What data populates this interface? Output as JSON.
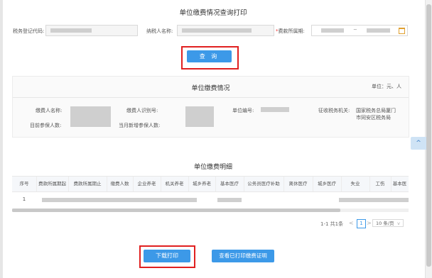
{
  "page_title": "单位缴费情况查询打印",
  "search": {
    "tax_code_label": "税务登记代码:",
    "taxpayer_name_label": "纳税人名称:",
    "period_required": "*",
    "period_label": "费款所属期:",
    "date_separator": "~",
    "calendar_icon": "calendar-icon",
    "query_label": "查 询"
  },
  "summary": {
    "title": "单位缴费情况",
    "unit": "单位：元、人",
    "payer_name_label": "缴费人名称:",
    "payer_id_label": "缴费人识别号:",
    "unit_no_label": "单位编号:",
    "tax_office_label": "征收税务机关:",
    "tax_office_value_line1": "国家税务总局厦门",
    "tax_office_value_line2": "市同安区税务局",
    "insured_count_label": "目前参保人数:",
    "new_insured_label": "当月新增参保人数:"
  },
  "detail": {
    "title": "单位缴费明细",
    "columns": [
      "序号",
      "费款所属期起",
      "费款所属期止",
      "缴费人数",
      "企业养老",
      "机关养老",
      "城乡养老",
      "基本医疗",
      "公务员医疗补助",
      "离休医疗",
      "城乡医疗",
      "失业",
      "工伤",
      "基本医"
    ],
    "rows": [
      {
        "index": "1"
      }
    ]
  },
  "pagination": {
    "summary": "1-1 共1条",
    "prev": "<",
    "current": "1",
    "next": ">",
    "page_size": "10 条/页",
    "page_size_arrow": "v"
  },
  "actions": {
    "download_print": "下载打印",
    "view_printed_cert": "查看已打印缴费证明"
  },
  "float_tab_icon": "chevron-up-icon",
  "float_tab_glyph": "^",
  "colors": {
    "accent": "#3c99e8",
    "highlight_border": "#e02020",
    "required": "#ee3333"
  }
}
